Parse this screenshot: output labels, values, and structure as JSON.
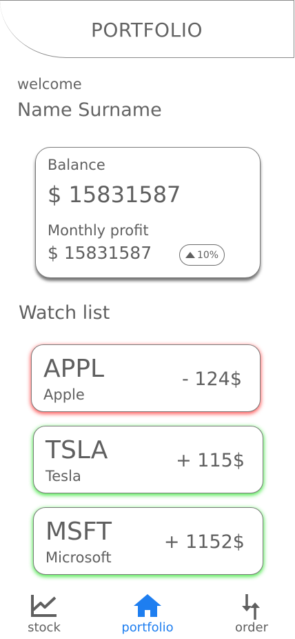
{
  "header": {
    "title": "PORTFOLIO"
  },
  "user": {
    "welcome": "welcome",
    "name": "Name Surname"
  },
  "balance": {
    "label": "Balance",
    "value": "$ 15831587",
    "monthly_label": "Monthly profit",
    "monthly_value": "$ 15831587",
    "badge": "10%",
    "badge_icon": "triangle-up-icon"
  },
  "watchlist": {
    "title": "Watch list",
    "items": [
      {
        "ticker": "APPL",
        "company": "Apple",
        "change": "- 124$",
        "status": "negative",
        "glow": "#ff4646"
      },
      {
        "ticker": "TSLA",
        "company": "Tesla",
        "change": "+ 115$",
        "status": "positive",
        "glow": "#3ce63c"
      },
      {
        "ticker": "MSFT",
        "company": "Microsoft",
        "change": "+ 1152$",
        "status": "positive",
        "glow": "#3ce63c"
      }
    ]
  },
  "nav": {
    "active": "portfolio",
    "accent_color": "#1e7ef0",
    "items": [
      {
        "label": "stock",
        "icon": "chart-line-icon"
      },
      {
        "label": "portfolio",
        "icon": "home-icon"
      },
      {
        "label": "order",
        "icon": "sort-arrows-icon"
      }
    ]
  }
}
